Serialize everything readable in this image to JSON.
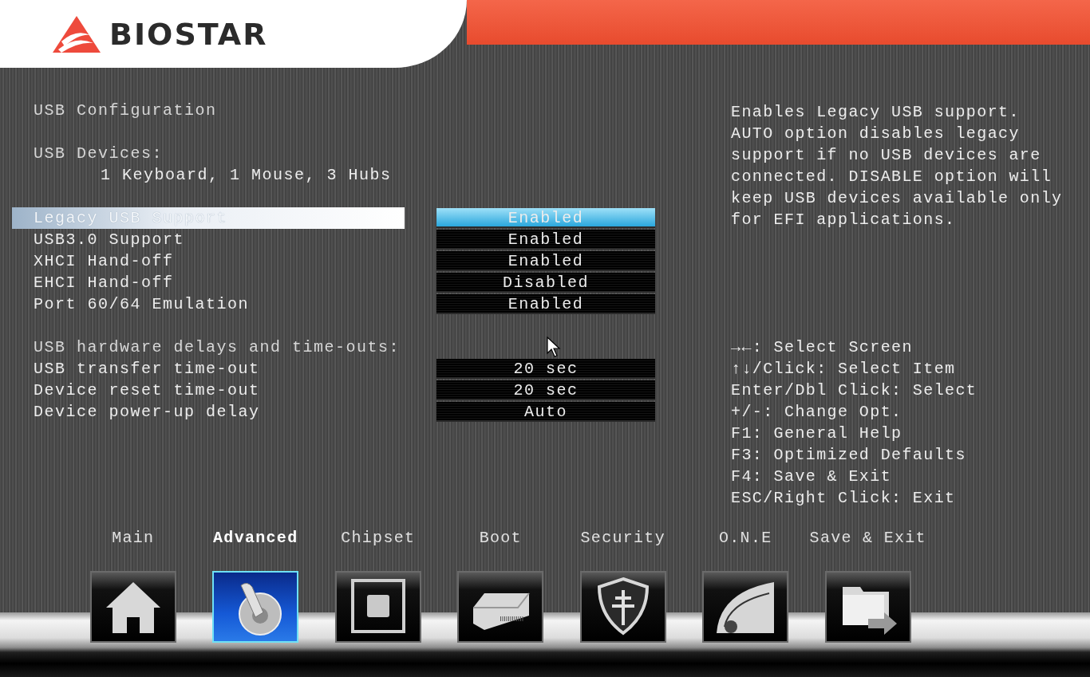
{
  "brand": {
    "name": "BIOSTAR"
  },
  "groups": [
    {
      "items": [
        {
          "kind": "heading",
          "label": "USB Configuration"
        }
      ]
    },
    {
      "items": [
        {
          "kind": "heading",
          "label": "USB Devices:"
        },
        {
          "kind": "info",
          "label": "1 Keyboard, 1 Mouse, 3 Hubs"
        }
      ]
    },
    {
      "items": [
        {
          "kind": "setting",
          "label": "Legacy USB Support",
          "value": "Enabled",
          "selected": true
        },
        {
          "kind": "setting",
          "label": "USB3.0 Support",
          "value": "Enabled",
          "selected": false
        },
        {
          "kind": "setting",
          "label": "XHCI Hand-off",
          "value": "Enabled",
          "selected": false
        },
        {
          "kind": "setting",
          "label": "EHCI Hand-off",
          "value": "Disabled",
          "selected": false
        },
        {
          "kind": "setting",
          "label": "Port 60/64 Emulation",
          "value": "Enabled",
          "selected": false
        }
      ]
    },
    {
      "items": [
        {
          "kind": "heading",
          "label": "USB hardware delays and time-outs:"
        },
        {
          "kind": "setting",
          "label": "USB transfer time-out",
          "value": "20 sec",
          "selected": false
        },
        {
          "kind": "setting",
          "label": "Device reset time-out",
          "value": "20 sec",
          "selected": false
        },
        {
          "kind": "setting",
          "label": "Device power-up delay",
          "value": "Auto",
          "selected": false
        }
      ]
    }
  ],
  "help": {
    "description": "Enables Legacy USB support. AUTO option disables legacy support if no USB devices are connected. DISABLE option will keep USB devices available only for EFI applications.",
    "keys": [
      "→←: Select Screen",
      "↑↓/Click: Select Item",
      "Enter/Dbl Click: Select",
      "+/-: Change Opt.",
      "F1: General Help",
      "F3: Optimized Defaults",
      "F4: Save & Exit",
      "ESC/Right Click: Exit"
    ]
  },
  "tabs": [
    {
      "label": "Main",
      "kind": "home",
      "selected": false
    },
    {
      "label": "Advanced",
      "kind": "advanced",
      "selected": true
    },
    {
      "label": "Chipset",
      "kind": "chipset",
      "selected": false
    },
    {
      "label": "Boot",
      "kind": "boot",
      "selected": false
    },
    {
      "label": "Security",
      "kind": "security",
      "selected": false
    },
    {
      "label": "O.N.E",
      "kind": "one",
      "selected": false
    },
    {
      "label": "Save & Exit",
      "kind": "exit",
      "selected": false
    }
  ]
}
